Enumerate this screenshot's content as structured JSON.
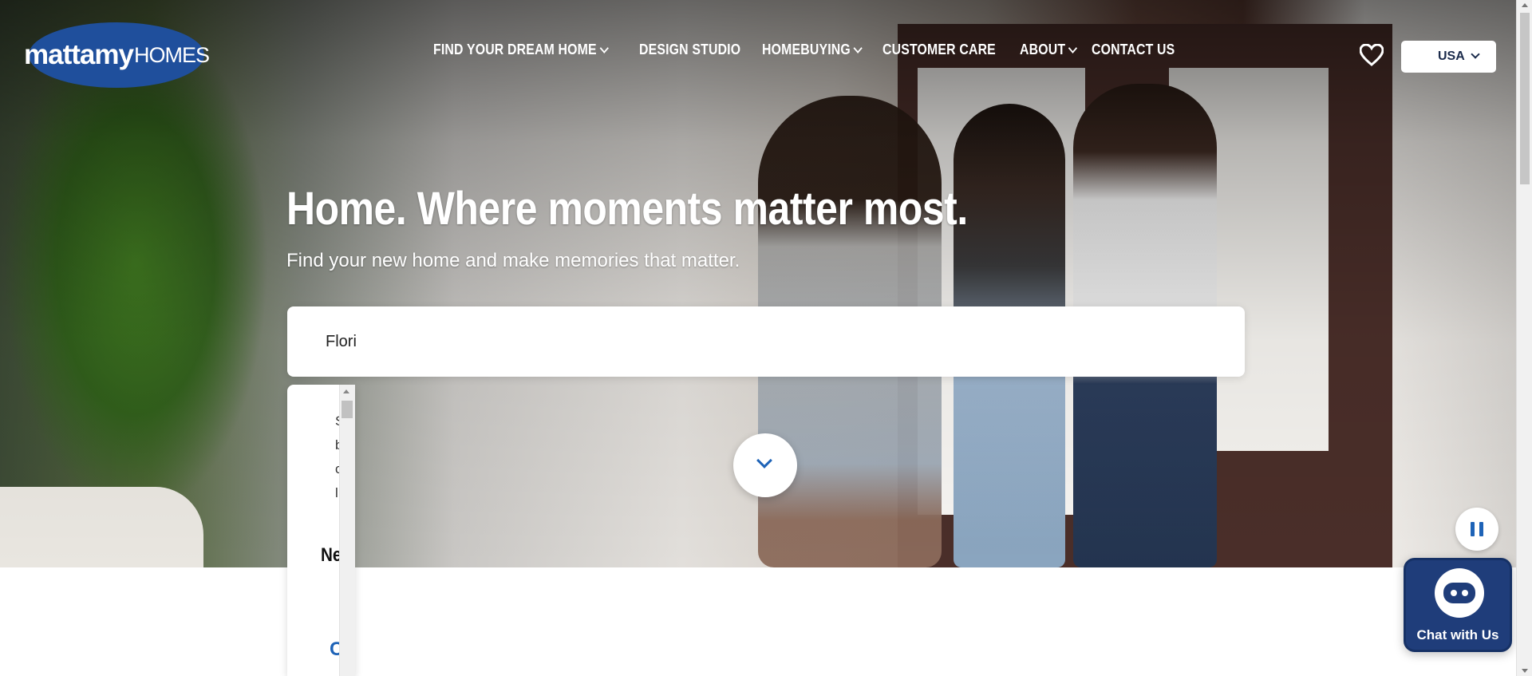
{
  "header": {
    "logo_main": "mattamy",
    "logo_sub": "HOMES",
    "nav": [
      {
        "label": "FIND YOUR DREAM HOME",
        "has_dropdown": true
      },
      {
        "label": "DESIGN STUDIO",
        "has_dropdown": false
      },
      {
        "label": "HOMEBUYING",
        "has_dropdown": true
      },
      {
        "label": "CUSTOMER CARE",
        "has_dropdown": false
      },
      {
        "label": "ABOUT",
        "has_dropdown": true
      },
      {
        "label": "CONTACT US",
        "has_dropdown": false
      }
    ],
    "country_selected": "USA",
    "favorites_icon": "heart-icon"
  },
  "hero": {
    "headline": "Home. Where moments matter most.",
    "subheadline": "Find your new home and make memories that matter."
  },
  "search": {
    "value": "Flori"
  },
  "suggestions": {
    "lines": [
      "S",
      "b",
      "c",
      "l"
    ],
    "title": "Ne res",
    "link": "C"
  },
  "chat": {
    "label": "Chat with Us"
  },
  "colors": {
    "brand_blue": "#1f4f9c",
    "link_blue": "#1e63b7",
    "chat_navy": "#1f3d7a"
  }
}
